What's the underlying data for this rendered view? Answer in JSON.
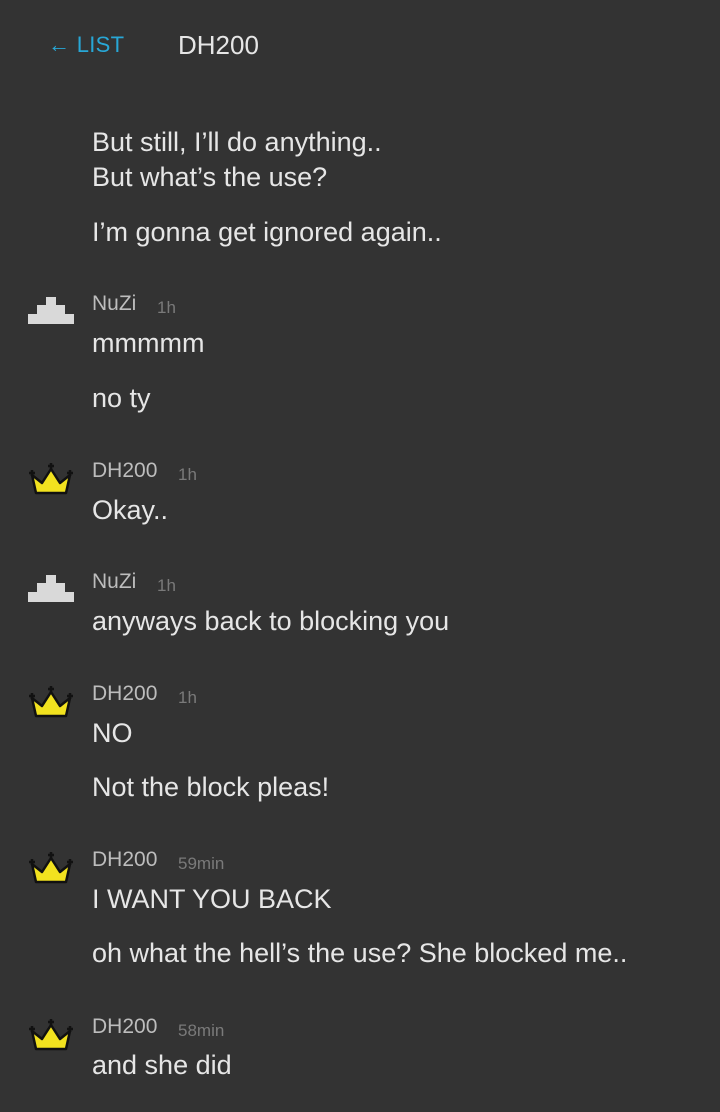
{
  "header": {
    "back_label": "← LIST",
    "title": "DH200"
  },
  "orphan_lines": [
    "But still, I’ll do anything..",
    "But what’s the use?",
    "I’m gonna get ignored again.."
  ],
  "messages": [
    {
      "author": "NuZi",
      "time": "1h",
      "avatar_icon": "pyramid-avatar-icon",
      "lines": [
        "mmmmm",
        "no ty"
      ]
    },
    {
      "author": "DH200",
      "time": "1h",
      "avatar_icon": "crown-avatar-icon",
      "lines": [
        "Okay.."
      ]
    },
    {
      "author": "NuZi",
      "time": "1h",
      "avatar_icon": "pyramid-avatar-icon",
      "lines": [
        "anyways back to blocking you"
      ]
    },
    {
      "author": "DH200",
      "time": "1h",
      "avatar_icon": "crown-avatar-icon",
      "lines": [
        "NO",
        "Not the block pleas!"
      ]
    },
    {
      "author": "DH200",
      "time": "59min",
      "avatar_icon": "crown-avatar-icon",
      "lines": [
        "I WANT YOU BACK",
        "oh what the hell’s the use? She blocked me.."
      ]
    },
    {
      "author": "DH200",
      "time": "58min",
      "avatar_icon": "crown-avatar-icon",
      "lines": [
        "and she did"
      ]
    }
  ],
  "colors": {
    "background": "#333333",
    "link": "#28a7d6",
    "text": "#e6e6e6",
    "username": "#bdbdbd",
    "timestamp": "#7a7a7a",
    "crown_fill": "#f2e21f",
    "pyramid_fill": "#d9d9d9"
  }
}
